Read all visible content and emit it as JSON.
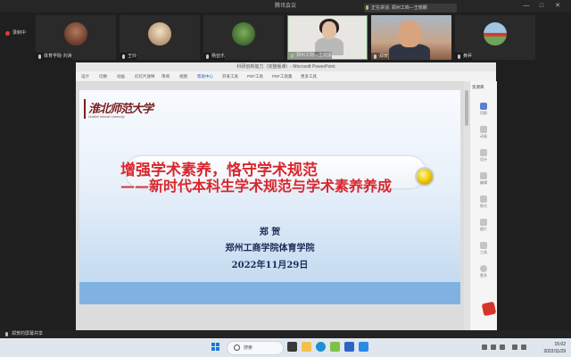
{
  "meeting": {
    "app_title": "腾讯会议",
    "recording_label": "录制中",
    "speaking_banner": "正在讲话: 郑州工商—王晓娜",
    "window_controls": [
      "—",
      "□",
      "✕"
    ]
  },
  "participants": [
    {
      "name": "体育学院-刘滑",
      "muted": true
    },
    {
      "name": "王玲",
      "muted": true
    },
    {
      "name": "杨亚乐",
      "muted": true
    },
    {
      "name": "郑州工商—王晓娜",
      "muted": false
    },
    {
      "name": "郑贺",
      "muted": true
    },
    {
      "name": "黄昇",
      "muted": true
    }
  ],
  "powerpoint": {
    "window_title": "科研创新能力（完整版课）- Microsoft PowerPoint",
    "ribbon_tabs": [
      "设计",
      "切换",
      "动画",
      "幻灯片放映",
      "审阅",
      "视图",
      "帮助中心",
      "开发工具",
      "PDF工具",
      "PDF工具集",
      "更多工具"
    ],
    "status_left": "第1张",
    "status_mid": "中文(中国)",
    "zoom": "91%",
    "right_panel_items": [
      "切换",
      "动画",
      "设计",
      "编辑",
      "格式",
      "图片",
      "工具",
      "更多"
    ],
    "right_panel_header": "资源库"
  },
  "slide": {
    "logo_text": "淮北师范大学",
    "logo_subtext": "Huaibei Normal University",
    "title_line1": "增强学术素养，恪守学术规范",
    "title_line2": "——新时代本科生学术规范与学术素养养成",
    "author": "郑 贺",
    "organization": "郑州工商学院体育学院",
    "date": "2022年11月29日"
  },
  "share_bar": {
    "label": "郑贺的屏幕共享"
  },
  "taskbar": {
    "search_placeholder": "搜索",
    "time": "15:02",
    "date": "2022/11/29"
  },
  "colors": {
    "title_red": "#d9262e",
    "author_navy": "#1a2a55",
    "slide_band_blue": "#7fb2e2",
    "active_speaker_green": "#4caf50"
  }
}
